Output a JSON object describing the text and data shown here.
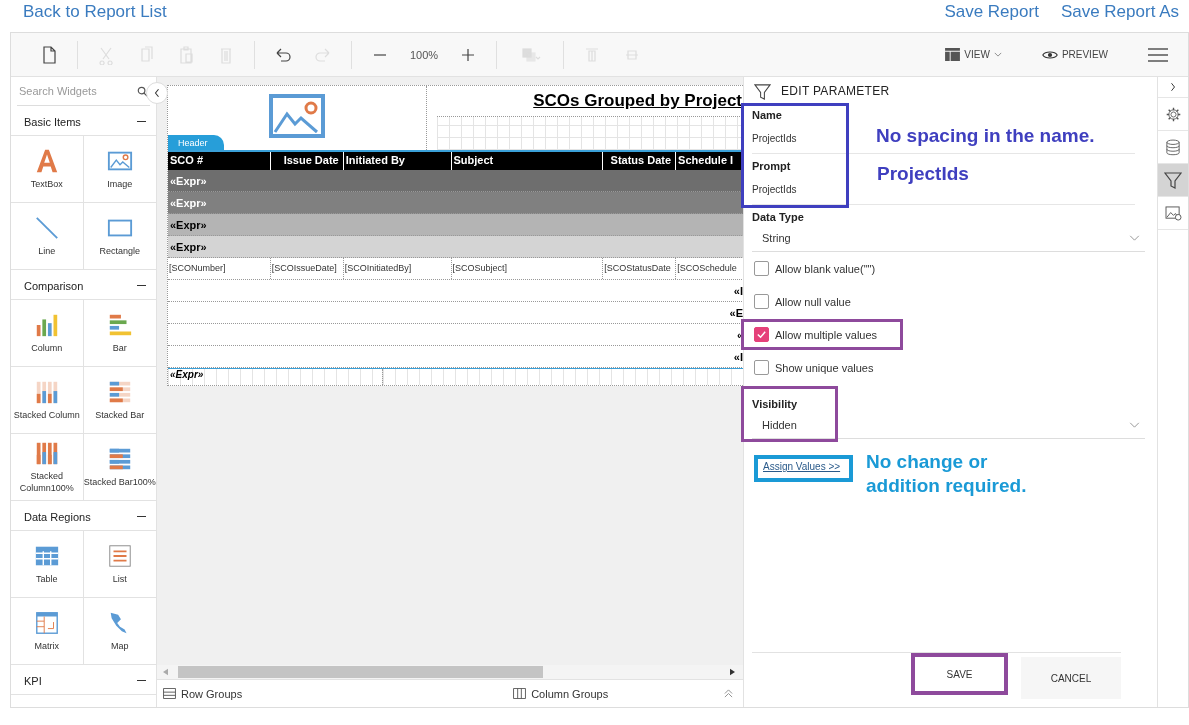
{
  "top_links": {
    "back": "Back to Report List",
    "actions": [
      "Save Report",
      "Save Report As"
    ]
  },
  "toolbar": {
    "groups": [
      [
        {
          "kind": "new",
          "disabled": false
        }
      ],
      [
        {
          "kind": "cut",
          "disabled": true
        },
        {
          "kind": "copy",
          "disabled": true
        },
        {
          "kind": "paste",
          "disabled": true
        },
        {
          "kind": "delete",
          "disabled": true
        }
      ],
      [
        {
          "kind": "undo",
          "disabled": false
        },
        {
          "kind": "redo",
          "disabled": true
        }
      ],
      [
        {
          "kind": "zoom-out",
          "disabled": false
        },
        {
          "kind": "zoom-level",
          "text": "100%",
          "disabled": false
        },
        {
          "kind": "zoom-in",
          "disabled": false
        }
      ],
      [
        {
          "kind": "layers",
          "disabled": true
        }
      ],
      [
        {
          "kind": "align-top",
          "disabled": true
        },
        {
          "kind": "align-middle",
          "disabled": true
        }
      ]
    ],
    "view": "VIEW",
    "preview": "PREVIEW"
  },
  "sidebar": {
    "search_placeholder": "Search Widgets",
    "sections": [
      {
        "title": "Basic Items",
        "expanded": true,
        "items": [
          {
            "label": "TextBox",
            "kind": "textbox"
          },
          {
            "label": "Image",
            "kind": "image"
          },
          {
            "label": "Line",
            "kind": "line"
          },
          {
            "label": "Rectangle",
            "kind": "rectangle"
          }
        ]
      },
      {
        "title": "Comparison",
        "expanded": true,
        "items": [
          {
            "label": "Column",
            "kind": "column"
          },
          {
            "label": "Bar",
            "kind": "bar"
          },
          {
            "label": "Stacked Column",
            "kind": "stacked-column"
          },
          {
            "label": "Stacked Bar",
            "kind": "stacked-bar"
          },
          {
            "label": "Stacked Column100%",
            "kind": "stacked-column-100"
          },
          {
            "label": "Stacked Bar100%",
            "kind": "stacked-bar-100"
          }
        ]
      },
      {
        "title": "Data Regions",
        "expanded": true,
        "items": [
          {
            "label": "Table",
            "kind": "table"
          },
          {
            "label": "List",
            "kind": "list"
          },
          {
            "label": "Matrix",
            "kind": "matrix"
          },
          {
            "label": "Map",
            "kind": "map"
          }
        ]
      },
      {
        "title": "KPI",
        "expanded": true
      }
    ]
  },
  "report": {
    "header_band": "Header",
    "title": "SCOs Grouped by Project",
    "columns": [
      "SCO #",
      "Issue Date",
      "Initiated By",
      "Subject",
      "Status Date",
      "Schedule I"
    ],
    "group_rows": [
      {
        "text": "«Expr»",
        "color": "#6e6e6e"
      },
      {
        "text": "«Expr»",
        "color": "#808080"
      },
      {
        "text": "«Expr»",
        "color": "#b4b4b4"
      },
      {
        "text": "«Expr»",
        "color": "#d4d4d4"
      }
    ],
    "detail_cells": [
      "[SCONumber]",
      "[SCOIssueDate]",
      "[SCOInitiatedBy]",
      "[SCOSubject]",
      "[SCOStatusDate",
      "[SCOSchedule"
    ],
    "footer_rows": [
      "«I",
      "«E",
      "«",
      "«I"
    ],
    "page_footer": "«Expr»"
  },
  "bottom_bar": {
    "row_groups": "Row Groups",
    "column_groups": "Column Groups"
  },
  "panel": {
    "title": "EDIT PARAMETER",
    "identity": {
      "highlighted": true,
      "fields": [
        {
          "label": "Name",
          "value": "ProjectIds"
        },
        {
          "label": "Prompt",
          "value": "ProjectIds"
        }
      ]
    },
    "data_type": {
      "label": "Data Type",
      "value": "String"
    },
    "options": [
      {
        "label": "Allow blank value(\"\")",
        "checked": false,
        "highlighted": false
      },
      {
        "label": "Allow null value",
        "checked": false,
        "highlighted": false
      },
      {
        "label": "Allow multiple values",
        "checked": true,
        "highlighted": true
      },
      {
        "label": "Show unique values",
        "checked": false,
        "highlighted": false
      }
    ],
    "visibility": {
      "label": "Visibility",
      "value": "Hidden",
      "highlighted": true
    },
    "assign_link": {
      "text": "Assign Values >>",
      "highlighted": true
    },
    "buttons": [
      {
        "label": "SAVE",
        "highlighted": true
      },
      {
        "label": "CANCEL",
        "highlighted": false
      }
    ]
  },
  "side_tabs": [
    {
      "kind": "collapse",
      "selected": false
    },
    {
      "kind": "settings",
      "selected": false
    },
    {
      "kind": "data",
      "selected": false
    },
    {
      "kind": "filter",
      "selected": true
    },
    {
      "kind": "image-settings",
      "selected": false
    }
  ],
  "annotations": [
    {
      "text": "No spacing in the name.",
      "color": "#3f3fbf"
    },
    {
      "text": "ProjectIds",
      "color": "#3f3fbf"
    },
    {
      "text": "No change or addition required.",
      "color": "#1a9ad6"
    }
  ]
}
